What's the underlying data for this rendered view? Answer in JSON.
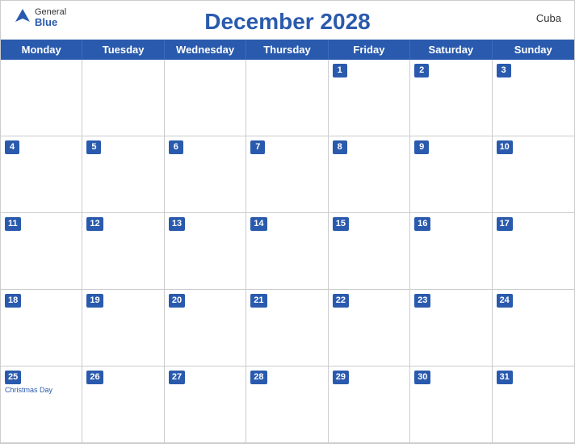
{
  "header": {
    "title": "December 2028",
    "country": "Cuba",
    "logo": {
      "general": "General",
      "blue": "Blue"
    }
  },
  "days": [
    "Monday",
    "Tuesday",
    "Wednesday",
    "Thursday",
    "Friday",
    "Saturday",
    "Sunday"
  ],
  "weeks": [
    [
      {
        "date": null
      },
      {
        "date": null
      },
      {
        "date": null
      },
      {
        "date": null
      },
      {
        "date": "1"
      },
      {
        "date": "2"
      },
      {
        "date": "3"
      }
    ],
    [
      {
        "date": "4"
      },
      {
        "date": "5"
      },
      {
        "date": "6"
      },
      {
        "date": "7"
      },
      {
        "date": "8"
      },
      {
        "date": "9"
      },
      {
        "date": "10"
      }
    ],
    [
      {
        "date": "11"
      },
      {
        "date": "12"
      },
      {
        "date": "13"
      },
      {
        "date": "14"
      },
      {
        "date": "15"
      },
      {
        "date": "16"
      },
      {
        "date": "17"
      }
    ],
    [
      {
        "date": "18"
      },
      {
        "date": "19"
      },
      {
        "date": "20"
      },
      {
        "date": "21"
      },
      {
        "date": "22"
      },
      {
        "date": "23"
      },
      {
        "date": "24"
      }
    ],
    [
      {
        "date": "25",
        "holiday": "Christmas Day"
      },
      {
        "date": "26"
      },
      {
        "date": "27"
      },
      {
        "date": "28"
      },
      {
        "date": "29"
      },
      {
        "date": "30"
      },
      {
        "date": "31"
      }
    ]
  ]
}
